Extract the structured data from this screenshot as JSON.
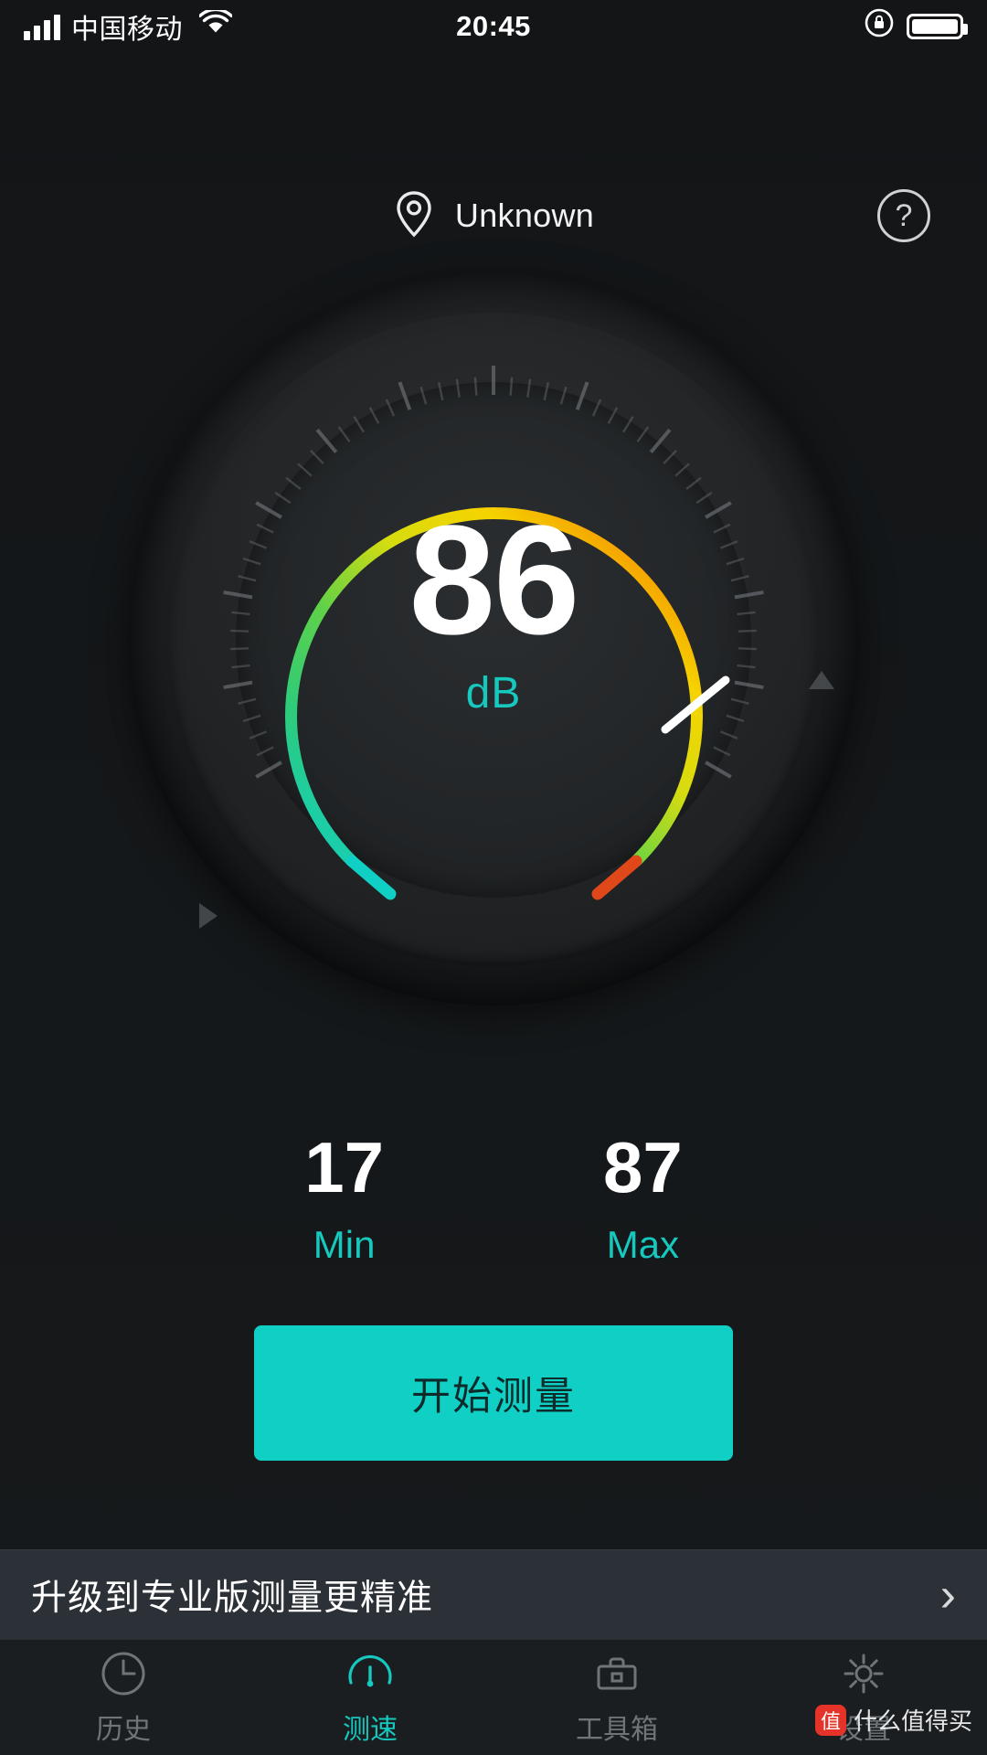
{
  "status_bar": {
    "carrier": "中国移动",
    "time": "20:45",
    "signal_icon": "signal-bars-icon",
    "wifi_icon": "wifi-icon",
    "lock_rotation_icon": "rotation-lock-icon",
    "battery_icon": "battery-icon"
  },
  "header": {
    "location_icon": "location-pin-icon",
    "location_label": "Unknown",
    "help_label": "?"
  },
  "gauge": {
    "value": "86",
    "unit": "dB",
    "min_angle_label": "",
    "accent_color": "#16c8bd",
    "arc_colors": [
      "#10cfc4",
      "#3ed16a",
      "#8fd42e",
      "#f3e000",
      "#f5a300",
      "#e2511b"
    ],
    "needle_color": "#ffffff"
  },
  "stats": [
    {
      "value": "17",
      "label": "Min"
    },
    {
      "value": "87",
      "label": "Max"
    }
  ],
  "primary_button": {
    "label": "开始测量"
  },
  "promo": {
    "text": "升级到专业版测量更精准",
    "chevron": "›"
  },
  "tabs": [
    {
      "label": "历史",
      "icon": "history-clock-icon",
      "active": false
    },
    {
      "label": "测速",
      "icon": "speedometer-icon",
      "active": true
    },
    {
      "label": "工具箱",
      "icon": "toolbox-icon",
      "active": false
    },
    {
      "label": "设置",
      "icon": "gear-icon",
      "active": false
    }
  ],
  "watermark": {
    "badge": "值",
    "text": "什么值得买"
  }
}
